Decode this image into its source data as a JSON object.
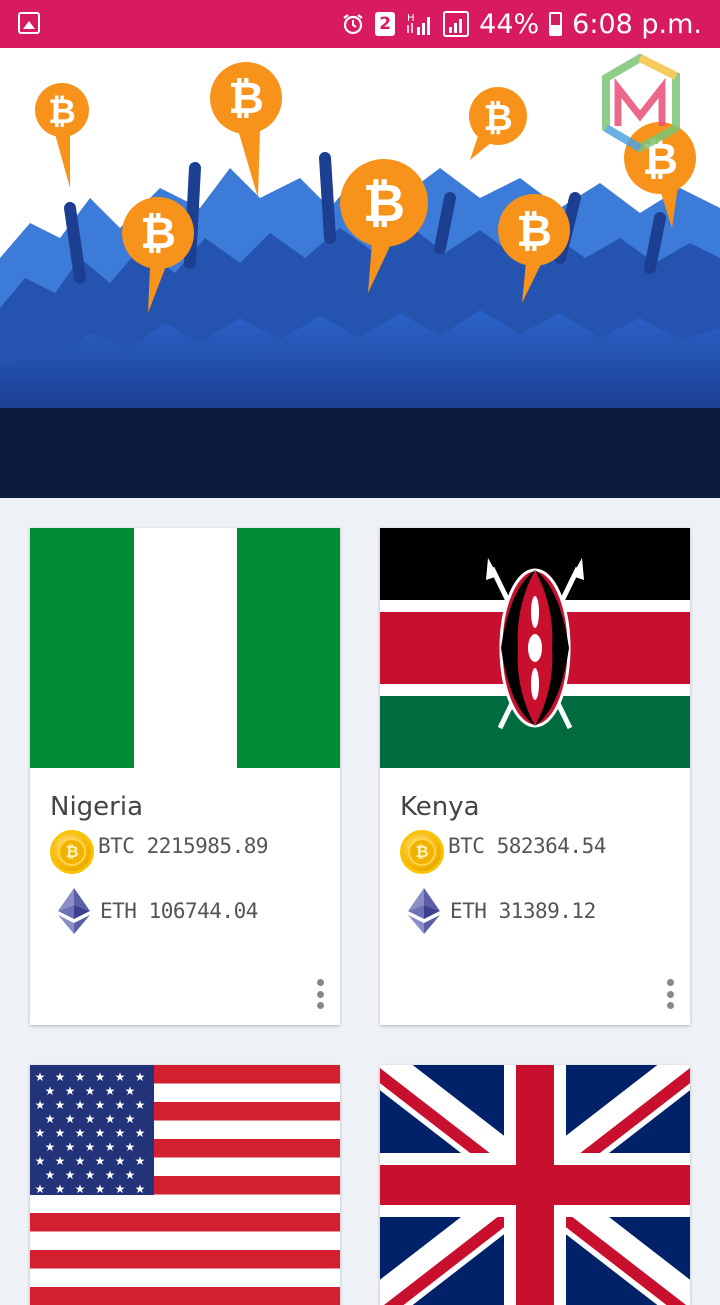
{
  "status_bar": {
    "sim_number": "2",
    "battery": "44%",
    "time": "6:08 p.m."
  },
  "hero": {
    "image": "bitcoin-crowd-illustration"
  },
  "countries": [
    {
      "name": "Nigeria",
      "btc": "BTC 2215985.89",
      "eth": "ETH 106744.04",
      "flag": "nigeria-flag"
    },
    {
      "name": "Kenya",
      "btc": "BTC 582364.54",
      "eth": "ETH 31389.12",
      "flag": "kenya-flag"
    },
    {
      "name": "",
      "btc": "",
      "eth": "",
      "flag": "usa-flag"
    },
    {
      "name": "",
      "btc": "",
      "eth": "",
      "flag": "uk-flag"
    }
  ],
  "colors": {
    "status_bar": "#d81b60",
    "btc_orange": "#f7931a",
    "background": "#eef1f5"
  }
}
